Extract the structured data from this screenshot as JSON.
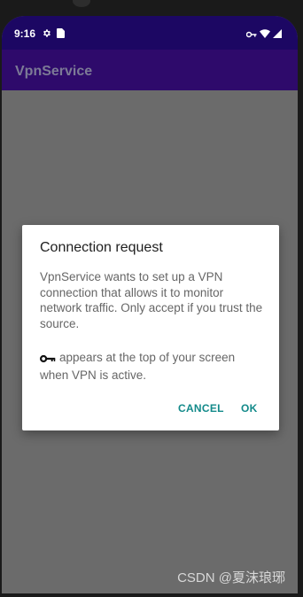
{
  "status_bar": {
    "time": "9:16",
    "icons_left": [
      "gear-icon",
      "sim-card-icon"
    ],
    "icons_right": [
      "vpn-key-icon",
      "wifi-icon",
      "signal-icon"
    ],
    "color": "#1c0763"
  },
  "app_bar": {
    "title": "VpnService",
    "color": "#2e0a6b"
  },
  "dialog": {
    "title": "Connection request",
    "message": "VpnService wants to set up a VPN connection that allows it to monitor network traffic. Only accept if you trust the source.",
    "note": "appears at the top of your screen when VPN is active.",
    "note_icon": "key-icon",
    "cancel_label": "CANCEL",
    "ok_label": "OK",
    "button_color": "#138a8a"
  },
  "watermark": "CSDN @夏沫琅琊"
}
